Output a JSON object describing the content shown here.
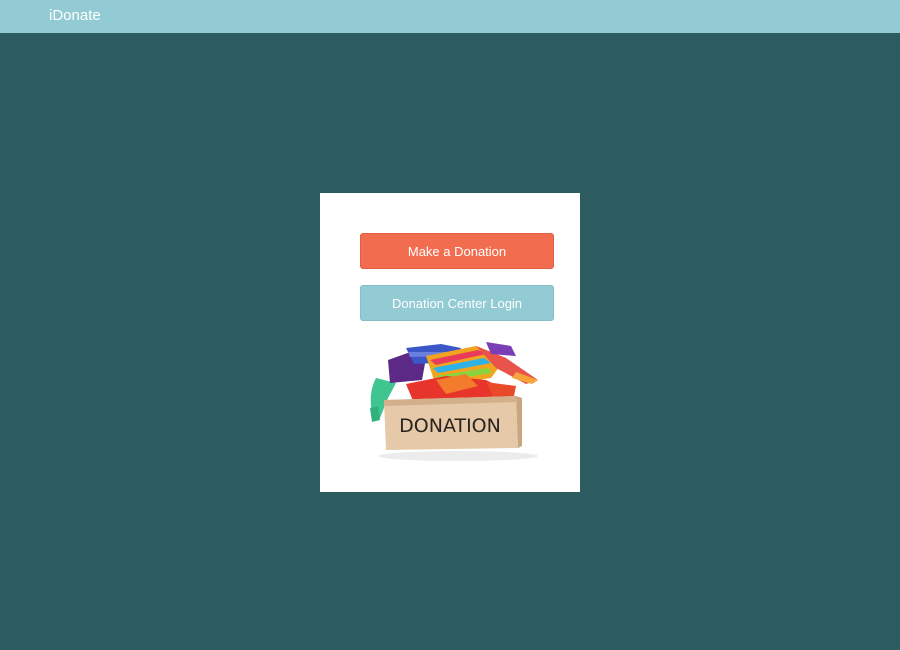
{
  "navbar": {
    "brand": "iDonate"
  },
  "card": {
    "donate_button_label": "Make a Donation",
    "login_button_label": "Donation Center Login",
    "illustration": {
      "icon": "donation-box-icon",
      "box_text": "DONATION"
    }
  },
  "colors": {
    "background": "#2d5c60",
    "navbar": "#92cbd3",
    "donate_button": "#f26d4f",
    "login_button": "#92cbd3",
    "card": "#ffffff"
  }
}
